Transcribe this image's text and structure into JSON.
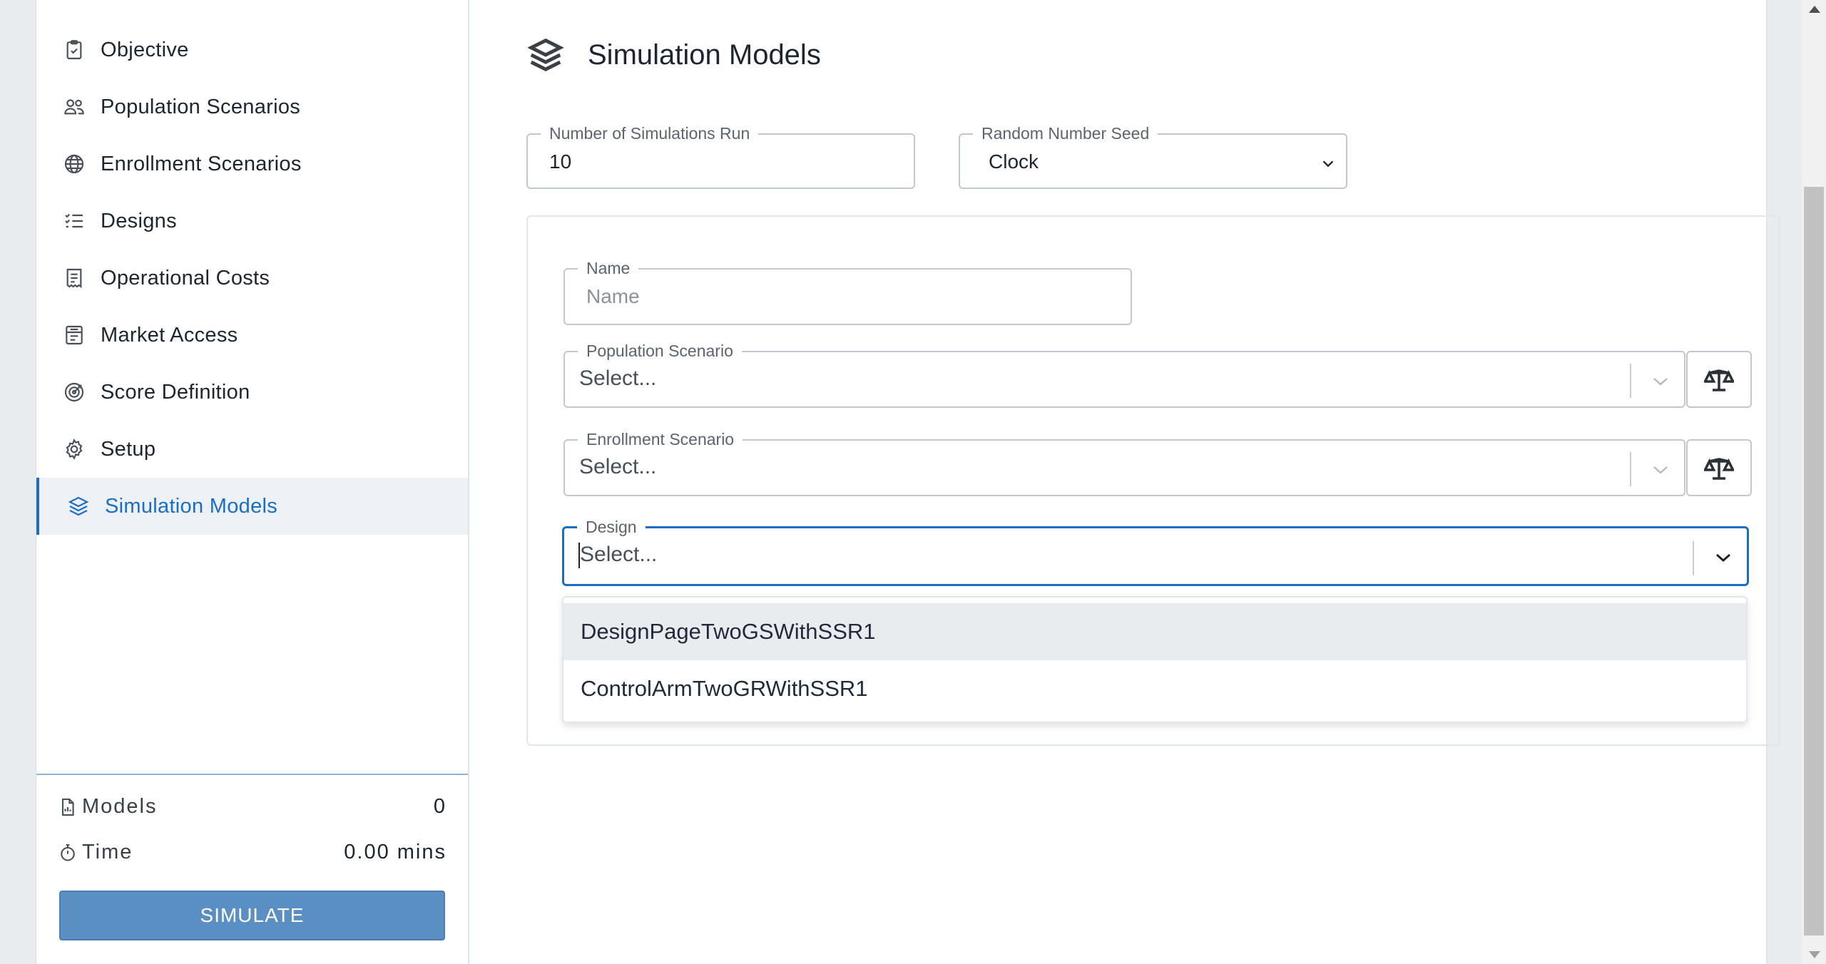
{
  "sidebar": {
    "items": [
      {
        "label": "Objective",
        "icon": "clipboard-check-icon"
      },
      {
        "label": "Population Scenarios",
        "icon": "users-icon"
      },
      {
        "label": "Enrollment Scenarios",
        "icon": "globe-icon"
      },
      {
        "label": "Designs",
        "icon": "list-check-icon"
      },
      {
        "label": "Operational Costs",
        "icon": "receipt-icon"
      },
      {
        "label": "Market Access",
        "icon": "form-icon"
      },
      {
        "label": "Score Definition",
        "icon": "target-icon"
      },
      {
        "label": "Setup",
        "icon": "gear-icon"
      },
      {
        "label": "Simulation Models",
        "icon": "layers-icon",
        "active": true
      }
    ],
    "footer": {
      "models_label": "Models",
      "models_value": "0",
      "time_label": "Time",
      "time_value": "0.00 mins",
      "simulate_label": "SIMULATE"
    }
  },
  "main": {
    "title": "Simulation Models",
    "num_sims_label": "Number of Simulations Run",
    "num_sims_value": "10",
    "seed_label": "Random Number Seed",
    "seed_value": "Clock",
    "form": {
      "name_label": "Name",
      "name_placeholder": "Name",
      "population_label": "Population Scenario",
      "population_placeholder": "Select...",
      "enrollment_label": "Enrollment Scenario",
      "enrollment_placeholder": "Select...",
      "design_label": "Design",
      "design_placeholder": "Select...",
      "design_options": [
        "DesignPageTwoGSWithSSR1",
        "ControlArmTwoGRWithSSR1"
      ]
    }
  },
  "colors": {
    "accent": "#1a6fc2",
    "button": "#5a8fc3",
    "active_bg": "#edf1f6"
  }
}
